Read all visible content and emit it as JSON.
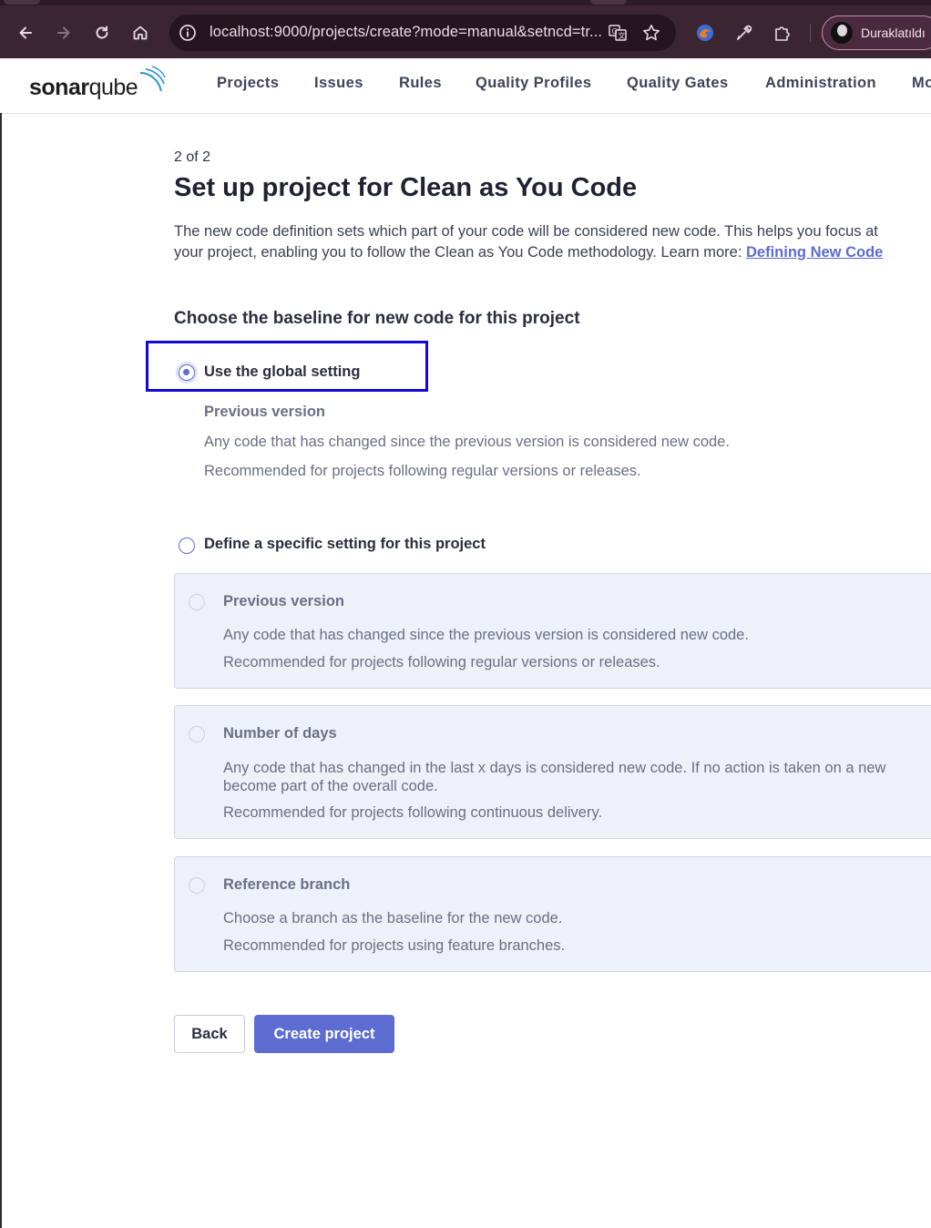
{
  "browser": {
    "url": "localhost:9000/projects/create?mode=manual&setncd=tr...",
    "profile_name": "Duraklatıldı"
  },
  "header": {
    "logo_text_bold": "sonar",
    "logo_text_regular": "qube",
    "nav": [
      "Projects",
      "Issues",
      "Rules",
      "Quality Profiles",
      "Quality Gates",
      "Administration",
      "Mo"
    ]
  },
  "page": {
    "step": "2 of 2",
    "title": "Set up project for Clean as You Code",
    "description_line1": "The new code definition sets which part of your code will be considered new code. This helps you focus at",
    "description_line2_prefix": "your project, enabling you to follow the Clean as You Code methodology. Learn more: ",
    "description_link": "Defining New Code",
    "baseline_heading": "Choose the baseline for new code for this project",
    "global_option": {
      "label": "Use the global setting",
      "selected": true,
      "detail_title": "Previous version",
      "detail_line1": "Any code that has changed since the previous version is considered new code.",
      "detail_line2": "Recommended for projects following regular versions or releases."
    },
    "specific_option": {
      "label": "Define a specific setting for this project",
      "selected": false
    },
    "cards": [
      {
        "title": "Previous version",
        "line1": "Any code that has changed since the previous version is considered new code.",
        "line2": "Recommended for projects following regular versions or releases."
      },
      {
        "title": "Number of days",
        "line1": "Any code that has changed in the last x days is considered new code. If no action is taken on a new",
        "line1b": "become part of the overall code.",
        "line2": "Recommended for projects following continuous delivery."
      },
      {
        "title": "Reference branch",
        "line1": "Choose a branch as the baseline for the new code.",
        "line2": "Recommended for projects using feature branches."
      }
    ],
    "buttons": {
      "back": "Back",
      "create": "Create project"
    }
  },
  "colors": {
    "accent": "#5d6cd0",
    "highlight_box": "#1408d6",
    "chrome_bg": "#3b2533"
  }
}
